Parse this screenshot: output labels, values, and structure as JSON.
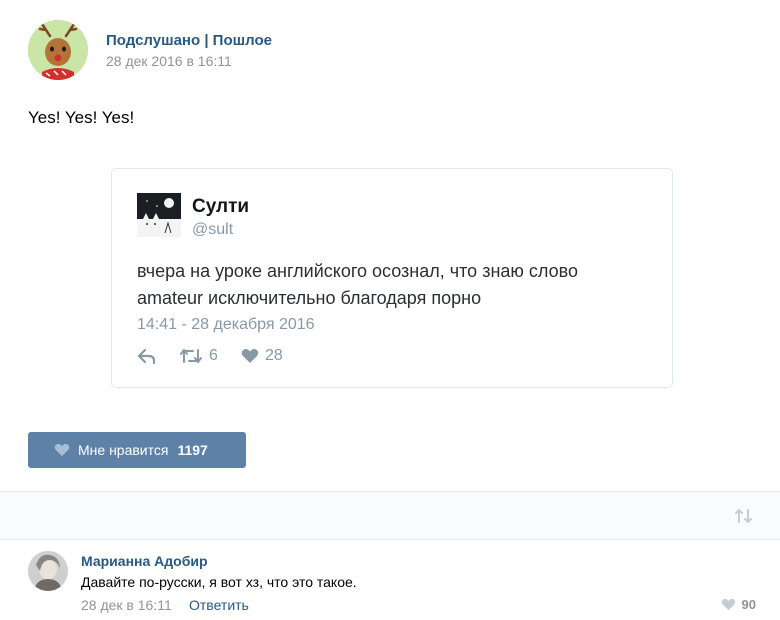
{
  "post": {
    "group_name": "Подслушано | Пошлое",
    "date": "28 дек 2016 в 16:11",
    "text": "Yes! Yes! Yes!",
    "avatar_icon": "reindeer-avatar-icon"
  },
  "tweet": {
    "author": "Султи",
    "handle": "@sult",
    "text": "вчера на уроке английского осознал, что знаю слово amateur исключительно благодаря порно",
    "time": "14:41 - 28 декабря 2016",
    "retweets": "6",
    "likes": "28"
  },
  "like_button": {
    "label": "Мне нравится",
    "count": "1197"
  },
  "comment": {
    "author": "Марианна Адобир",
    "text": "Давайте по-русски, я вот хз, что это такое.",
    "date": "28 дек в 16:11",
    "reply_label": "Ответить",
    "likes": "90"
  },
  "colors": {
    "link": "#2a5885",
    "like_button_bg": "#5e81a8",
    "muted": "#939393",
    "tweet_muted": "#8899a6"
  }
}
